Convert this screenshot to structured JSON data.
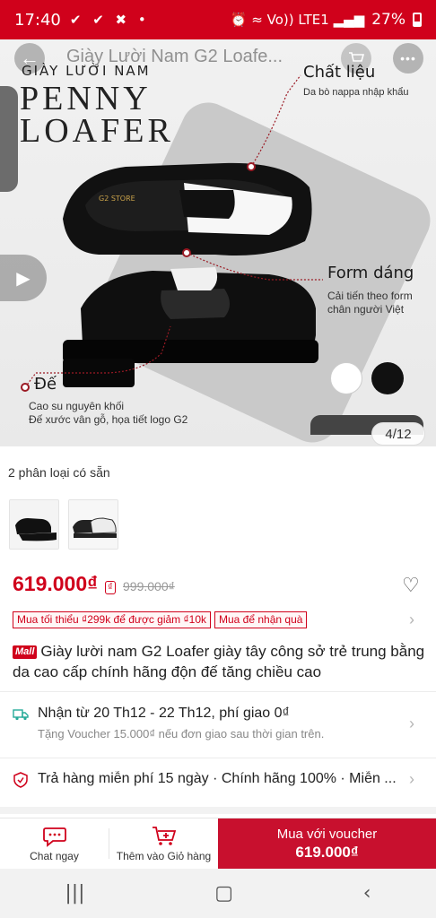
{
  "status_bar": {
    "time": "17:40",
    "system_icons": "✔ ✔ ✖ •",
    "right_icons": "⏰ ≈ Vo)) LTE1 ▂▄▆",
    "battery": "27%"
  },
  "header": {
    "title": "Giày Lười Nam G2 Loafe..."
  },
  "hero": {
    "brand_line": "GIÀY LƯỜI NAM",
    "headline_1": "PENNY",
    "headline_2": "LOAFER",
    "features": [
      {
        "title": "Chất liệu",
        "sub": "Da bò nappa nhập khẩu"
      },
      {
        "title": "Form dáng",
        "sub": "Cải tiến theo form\nchân người Việt"
      },
      {
        "title": "Đế",
        "sub": "Cao su nguyên khối\nĐế xước vân gỗ, họa tiết logo G2"
      }
    ],
    "image_counter": "4/12",
    "shoe_logo": "G2 STORE"
  },
  "variants": {
    "label": "2 phân loại có sẵn"
  },
  "pricing": {
    "price": "619.000₫",
    "badge": "₫",
    "old_price": "999.000₫"
  },
  "promos": [
    "Mua tối thiểu ₫299k để được giảm ₫10k",
    "Mua để nhận quà"
  ],
  "product": {
    "mall_badge": "Mall",
    "title": "Giày lười nam G2 Loafer giày tây công sở trẻ trung bằng da cao cấp chính hãng độn đế tăng chiều cao"
  },
  "shipping": {
    "main": "Nhận từ 20 Th12 - 22 Th12, phí giao 0₫",
    "sub": "Tặng Voucher 15.000₫ nếu đơn giao sau thời gian trên."
  },
  "returns": {
    "text": "Trả hàng miễn phí 15 ngày · Chính hãng 100% · Miễn ..."
  },
  "action_bar": {
    "chat_label": "Chat ngay",
    "cart_label": "Thêm vào Giỏ hàng",
    "buy_top": "Mua với voucher",
    "buy_bottom": "619.000₫"
  },
  "colors": {
    "brand_red": "#d0011b",
    "buy_button": "#c8102e"
  }
}
